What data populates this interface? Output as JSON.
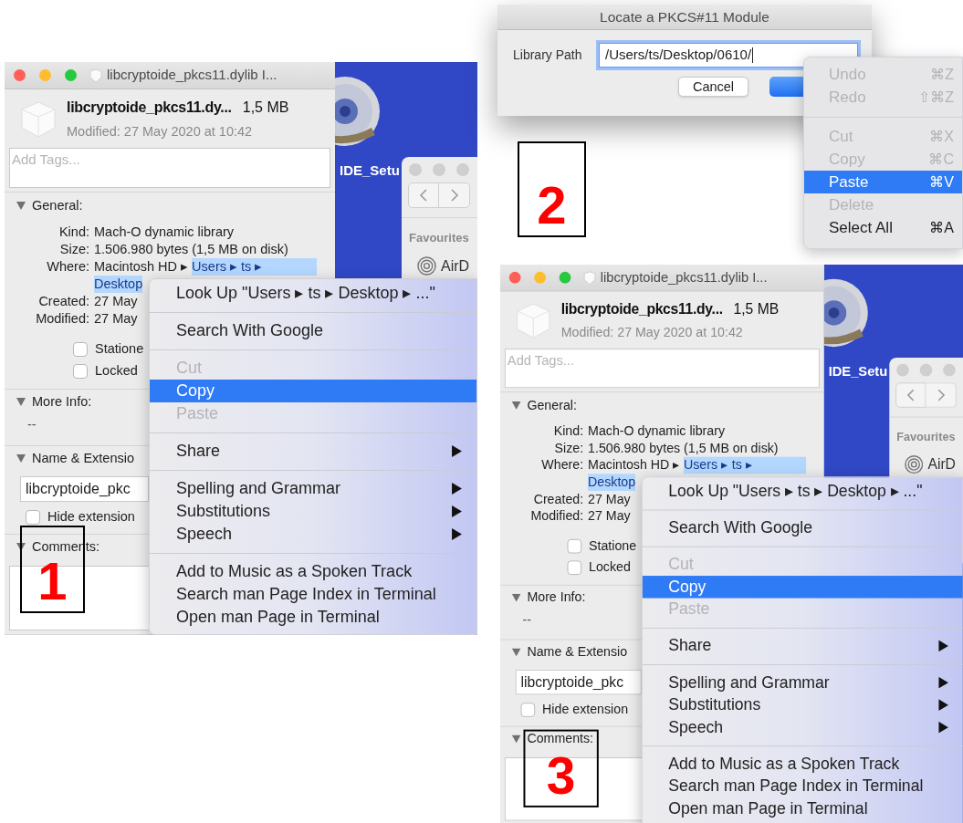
{
  "steps": [
    {
      "kind": "info_window",
      "number": "1",
      "title": "libcryptoide_pkcs11.dylib I...",
      "file_name": "libcryptoide_pkcs11.dy...",
      "file_size": "1,5 MB",
      "modified_summary": "Modified: 27 May 2020 at 10:42",
      "tags_placeholder": "Add Tags...",
      "general": {
        "header": "General:",
        "expanded": true,
        "rows": [
          {
            "label": "Kind:",
            "value": "Mach-O dynamic library"
          },
          {
            "label": "Size:",
            "value": "1.506.980 bytes (1,5 MB on disk)"
          },
          {
            "label": "Where:",
            "lines": [
              [
                {
                  "text": "Macintosh HD ▸",
                  "selected": false
                },
                {
                  "text": "Users ▸ ts ▸",
                  "selected": true
                }
              ],
              [
                {
                  "text": "Desktop",
                  "selected": true
                }
              ]
            ]
          },
          {
            "label": "Created:",
            "value": "27 May"
          },
          {
            "label": "Modified:",
            "value": "27 May"
          }
        ],
        "checkboxes": [
          {
            "label": "Statione",
            "checked": false
          },
          {
            "label": "Locked",
            "checked": false
          }
        ]
      },
      "more_info": {
        "header": "More Info:",
        "expanded": true,
        "value": "--"
      },
      "name_extension": {
        "header": "Name & Extensio",
        "expanded": true,
        "value": "libcryptoide_pkc",
        "checkbox": {
          "label": "Hide extension",
          "checked": false
        }
      },
      "comments": {
        "header": "Comments:",
        "expanded": true
      },
      "desktop": {
        "icon_label": "IDE_Setu",
        "finder": {
          "sidebar_heading": "Favourites",
          "sidebar_item": "AirD"
        }
      },
      "context_menu": {
        "groups": [
          [
            {
              "label": "Look Up \"Users ▸ ts ▸ Desktop ▸ ...\"",
              "disabled": false,
              "selected": false,
              "submenu": false
            }
          ],
          [
            {
              "label": "Search With Google",
              "disabled": false,
              "selected": false,
              "submenu": false
            }
          ],
          [
            {
              "label": "Cut",
              "disabled": true,
              "selected": false,
              "submenu": false
            },
            {
              "label": "Copy",
              "disabled": false,
              "selected": true,
              "submenu": false
            },
            {
              "label": "Paste",
              "disabled": true,
              "selected": false,
              "submenu": false
            }
          ],
          [
            {
              "label": "Share",
              "disabled": false,
              "selected": false,
              "submenu": true
            }
          ],
          [
            {
              "label": "Spelling and Grammar",
              "disabled": false,
              "selected": false,
              "submenu": true
            },
            {
              "label": "Substitutions",
              "disabled": false,
              "selected": false,
              "submenu": true
            },
            {
              "label": "Speech",
              "disabled": false,
              "selected": false,
              "submenu": true
            }
          ],
          [
            {
              "label": "Add to Music as a Spoken Track",
              "disabled": false,
              "selected": false,
              "submenu": false
            },
            {
              "label": "Search man Page Index in Terminal",
              "disabled": false,
              "selected": false,
              "submenu": false
            },
            {
              "label": "Open man Page in Terminal",
              "disabled": false,
              "selected": false,
              "submenu": false
            }
          ]
        ]
      }
    },
    {
      "kind": "dialog",
      "number": "2",
      "title": "Locate a PKCS#11 Module",
      "field_label": "Library Path",
      "field_value": "/Users/ts/Desktop/0610/",
      "field_focused": true,
      "buttons": [
        {
          "label": "Cancel",
          "default": false
        },
        {
          "default": true
        }
      ],
      "edit_menu": {
        "groups": [
          [
            {
              "label": "Undo",
              "shortcut": "⌘Z",
              "disabled": true,
              "selected": false
            },
            {
              "label": "Redo",
              "shortcut": "⇧⌘Z",
              "disabled": true,
              "selected": false
            }
          ],
          [
            {
              "label": "Cut",
              "shortcut": "⌘X",
              "disabled": true,
              "selected": false
            },
            {
              "label": "Copy",
              "shortcut": "⌘C",
              "disabled": true,
              "selected": false
            },
            {
              "label": "Paste",
              "shortcut": "⌘V",
              "disabled": false,
              "selected": true
            },
            {
              "label": "Delete",
              "disabled": true,
              "selected": false
            },
            {
              "label": "Select All",
              "shortcut": "⌘A",
              "disabled": false,
              "selected": false
            }
          ]
        ]
      }
    },
    {
      "kind": "info_window",
      "number": "3",
      "title": "libcryptoide_pkcs11.dylib I...",
      "file_name": "libcryptoide_pkcs11.dy...",
      "file_size": "1,5 MB",
      "modified_summary": "Modified: 27 May 2020 at 10:42",
      "tags_placeholder": "Add Tags...",
      "general": {
        "header": "General:",
        "expanded": true,
        "rows": [
          {
            "label": "Kind:",
            "value": "Mach-O dynamic library"
          },
          {
            "label": "Size:",
            "value": "1.506.980 bytes (1,5 MB on disk)"
          },
          {
            "label": "Where:",
            "lines": [
              [
                {
                  "text": "Macintosh HD ▸",
                  "selected": false
                },
                {
                  "text": "Users ▸ ts ▸",
                  "selected": true
                }
              ],
              [
                {
                  "text": "Desktop",
                  "selected": true
                }
              ]
            ]
          },
          {
            "label": "Created:",
            "value": "27 May"
          },
          {
            "label": "Modified:",
            "value": "27 May"
          }
        ],
        "checkboxes": [
          {
            "label": "Statione",
            "checked": false
          },
          {
            "label": "Locked",
            "checked": false
          }
        ]
      },
      "more_info": {
        "header": "More Info:",
        "expanded": true,
        "value": "--"
      },
      "name_extension": {
        "header": "Name & Extensio",
        "expanded": true,
        "value": "libcryptoide_pkc",
        "checkbox": {
          "label": "Hide extension",
          "checked": false
        }
      },
      "comments": {
        "header": "Comments:",
        "expanded": true
      },
      "desktop": {
        "icon_label": "IDE_Setu",
        "finder": {
          "sidebar_heading": "Favourites",
          "sidebar_item": "AirD"
        }
      },
      "context_menu": {
        "groups": [
          [
            {
              "label": "Look Up \"Users ▸ ts ▸ Desktop ▸ ...\"",
              "disabled": false,
              "selected": false,
              "submenu": false
            }
          ],
          [
            {
              "label": "Search With Google",
              "disabled": false,
              "selected": false,
              "submenu": false
            }
          ],
          [
            {
              "label": "Cut",
              "disabled": true,
              "selected": false,
              "submenu": false
            },
            {
              "label": "Copy",
              "disabled": false,
              "selected": true,
              "submenu": false
            },
            {
              "label": "Paste",
              "disabled": true,
              "selected": false,
              "submenu": false
            }
          ],
          [
            {
              "label": "Share",
              "disabled": false,
              "selected": false,
              "submenu": true
            }
          ],
          [
            {
              "label": "Spelling and Grammar",
              "disabled": false,
              "selected": false,
              "submenu": true
            },
            {
              "label": "Substitutions",
              "disabled": false,
              "selected": false,
              "submenu": true
            },
            {
              "label": "Speech",
              "disabled": false,
              "selected": false,
              "submenu": true
            }
          ],
          [
            {
              "label": "Add to Music as a Spoken Track",
              "disabled": false,
              "selected": false,
              "submenu": false
            },
            {
              "label": "Search man Page Index in Terminal",
              "disabled": false,
              "selected": false,
              "submenu": false
            },
            {
              "label": "Open man Page in Terminal",
              "disabled": false,
              "selected": false,
              "submenu": false
            }
          ]
        ]
      }
    }
  ]
}
